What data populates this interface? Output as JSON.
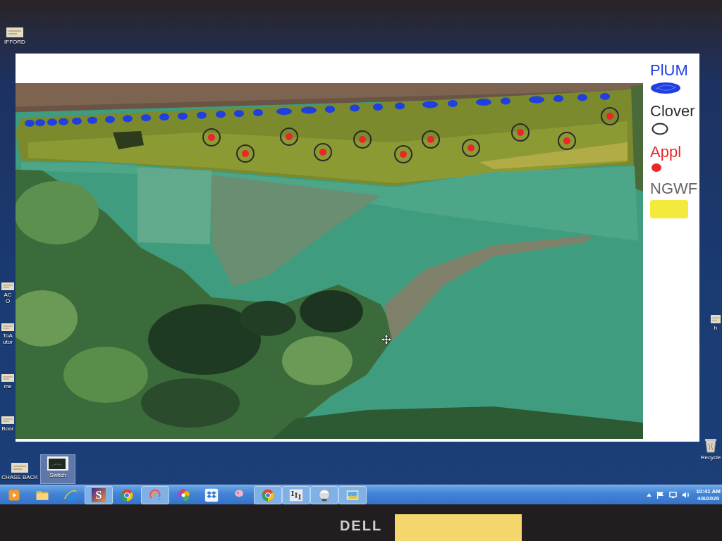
{
  "desktop": {
    "icons": [
      {
        "label": "IFFORD",
        "kind": "file",
        "selected": false
      },
      {
        "label": "AC\nO",
        "kind": "file",
        "selected": false
      },
      {
        "label": "ToA\nutor",
        "kind": "file",
        "selected": false
      },
      {
        "label": "me",
        "kind": "file",
        "selected": false
      },
      {
        "label": "Boor",
        "kind": "file",
        "selected": false
      },
      {
        "label": "CHASE BACK",
        "kind": "file",
        "selected": false
      },
      {
        "label": "Switch",
        "kind": "thumbnail",
        "selected": true
      },
      {
        "label": "h",
        "kind": "file",
        "selected": false
      },
      {
        "label": "Recycle",
        "kind": "recycle-bin",
        "selected": false
      }
    ]
  },
  "image_window": {
    "legend": [
      {
        "label": "PlUM",
        "kind": "scribble",
        "color": "#1f3fe0"
      },
      {
        "label": "Clover",
        "kind": "ring",
        "color": "#2b2b2b"
      },
      {
        "label": "Appl",
        "kind": "dot",
        "color": "#e8262b"
      },
      {
        "label": "NGWF",
        "kind": "band",
        "color": "#f2ea3c"
      }
    ]
  },
  "taskbar": {
    "items": [
      {
        "kind": "media",
        "running": false
      },
      {
        "kind": "folder",
        "running": false
      },
      {
        "kind": "browser-e",
        "running": false
      },
      {
        "kind": "letter-tile",
        "glyph": "S",
        "running": true
      },
      {
        "kind": "tricolor",
        "running": false
      },
      {
        "kind": "swirl",
        "running": true
      },
      {
        "kind": "pinwheel",
        "running": false
      },
      {
        "kind": "box",
        "running": false
      },
      {
        "kind": "paint",
        "running": false
      },
      {
        "kind": "tricolor",
        "running": true
      },
      {
        "kind": "columns",
        "running": true
      },
      {
        "kind": "disc",
        "running": true
      },
      {
        "kind": "picture",
        "running": true
      }
    ],
    "tray": {
      "time": "10:41 AM",
      "date": "4/8/2020"
    }
  },
  "monitor": {
    "brand": "DELL"
  }
}
